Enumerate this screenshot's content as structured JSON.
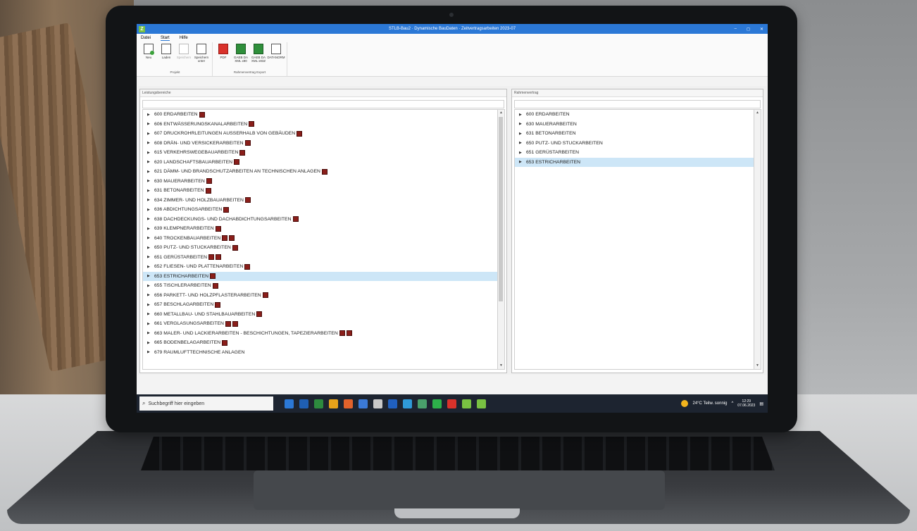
{
  "window": {
    "title": "STLB-Bau2 · Dynamische BauDaten · Zeitvertragsarbeiten 2023-07",
    "app_icon": "Z"
  },
  "window_controls": {
    "minimize": "–",
    "maximize": "◻",
    "close": "✕"
  },
  "menu": {
    "tabs": [
      "Datei",
      "Start",
      "Hilfe"
    ],
    "active": "Start"
  },
  "ribbon": {
    "groups": [
      {
        "label": "Projekt",
        "buttons": [
          {
            "label": "Neu",
            "icon": "new-file-icon",
            "enabled": true
          },
          {
            "label": "Laden",
            "icon": "open-file-icon",
            "enabled": true
          },
          {
            "label": "Speichern",
            "icon": "save-icon",
            "enabled": false
          },
          {
            "label": "Speichern unter",
            "icon": "save-as-icon",
            "enabled": true
          }
        ]
      },
      {
        "label": "Rahmenvertrag Export",
        "buttons": [
          {
            "label": "PDF",
            "icon": "pdf-icon",
            "enabled": true
          },
          {
            "label": "GAEB DA XML x80",
            "icon": "xml-icon",
            "enabled": true
          },
          {
            "label": "GAEB DA XML x83Z",
            "icon": "xml-icon",
            "enabled": true
          },
          {
            "label": "DATANORM",
            "icon": "datanorm-icon",
            "enabled": true
          }
        ]
      }
    ]
  },
  "left_pane": {
    "header": "Leistungsbereiche",
    "items": [
      {
        "label": "600 ERDARBEITEN",
        "books": 1
      },
      {
        "label": "606 ENTWÄSSERUNGSKANALARBEITEN",
        "books": 1
      },
      {
        "label": "607 DRUCKROHRLEITUNGEN AUSSERHALB VON GEBÄUDEN",
        "books": 1
      },
      {
        "label": "608 DRÄN- UND VERSICKERARBEITEN",
        "books": 1
      },
      {
        "label": "615 VERKEHRSWEGEBAUARBEITEN",
        "books": 1
      },
      {
        "label": "620 LANDSCHAFTSBAUARBEITEN",
        "books": 1
      },
      {
        "label": "621 DÄMM- UND BRANDSCHUTZARBEITEN AN TECHNISCHEN ANLAGEN",
        "books": 1
      },
      {
        "label": "630 MAUERARBEITEN",
        "books": 1
      },
      {
        "label": "631 BETONARBEITEN",
        "books": 1
      },
      {
        "label": "634 ZIMMER- UND HOLZBAUARBEITEN",
        "books": 1
      },
      {
        "label": "636 ABDICHTUNGSARBEITEN",
        "books": 1
      },
      {
        "label": "638 DACHDECKUNGS- UND DACHABDICHTUNGSARBEITEN",
        "books": 1
      },
      {
        "label": "639 KLEMPNERARBEITEN",
        "books": 1
      },
      {
        "label": "640 TROCKENBAUARBEITEN",
        "books": 2
      },
      {
        "label": "650 PUTZ- UND STUCKARBEITEN",
        "books": 1
      },
      {
        "label": "651 GERÜSTARBEITEN",
        "books": 2
      },
      {
        "label": "652 FLIESEN- UND PLATTENARBEITEN",
        "books": 1
      },
      {
        "label": "653 ESTRICHARBEITEN",
        "books": 1,
        "selected": true
      },
      {
        "label": "655 TISCHLERARBEITEN",
        "books": 1
      },
      {
        "label": "656 PARKETT- UND HOLZPFLASTERARBEITEN",
        "books": 1
      },
      {
        "label": "657 BESCHLAGARBEITEN",
        "books": 1
      },
      {
        "label": "660 METALLBAU- UND STAHLBAUARBEITEN",
        "books": 1
      },
      {
        "label": "661 VERGLASUNGSARBEITEN",
        "books": 2
      },
      {
        "label": "663 MALER- UND LACKIERARBEITEN - BESCHICHTUNGEN, TAPEZIERARBEITEN",
        "books": 2
      },
      {
        "label": "665 BODENBELAGARBEITEN",
        "books": 1
      },
      {
        "label": "679 RAUMLUFTTECHNISCHE ANLAGEN",
        "books": 0
      }
    ]
  },
  "right_pane": {
    "header": "Rahmenvertrag",
    "items": [
      {
        "label": "600 ERDARBEITEN"
      },
      {
        "label": "630 MAUERARBEITEN"
      },
      {
        "label": "631 BETONARBEITEN"
      },
      {
        "label": "650 PUTZ- UND STUCKARBEITEN"
      },
      {
        "label": "651 GERÜSTARBEITEN"
      },
      {
        "label": "653 ESTRICHARBEITEN",
        "selected": true
      }
    ]
  },
  "taskbar": {
    "search_placeholder": "Suchbegriff hier eingeben",
    "weather": "24°C  Teilw. sonnig",
    "time": "12:29",
    "date": "07.06.2023",
    "app_colors": [
      "#2b78d6",
      "#1f5fb4",
      "#2d8a3e",
      "#e8a31a",
      "#e2622b",
      "#3b7ad8",
      "#c8c8c8",
      "#2060c0",
      "#2f9ad8",
      "#49a06b",
      "#2db04a",
      "#d9322b",
      "#79c142",
      "#79c142"
    ]
  },
  "colors": {
    "accent": "#2b78d6",
    "selection": "#cde6f7",
    "brand_green": "#79c142"
  }
}
